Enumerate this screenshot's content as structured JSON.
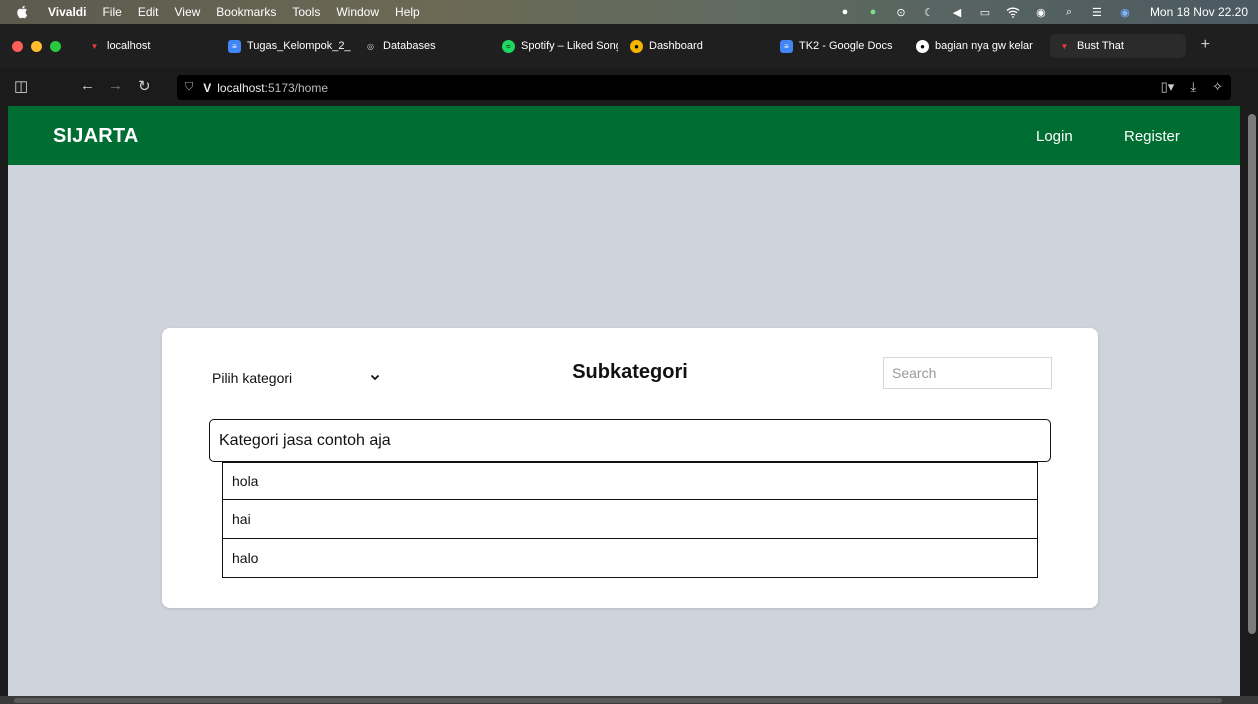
{
  "menubar": {
    "app_name": "Vivaldi",
    "items": [
      "File",
      "Edit",
      "View",
      "Bookmarks",
      "Tools",
      "Window",
      "Help"
    ],
    "clock": "Mon 18 Nov 22.20"
  },
  "tabs": [
    {
      "label": "localhost",
      "icon": "vivaldi-icon",
      "color": "#ef3939"
    },
    {
      "label": "Tugas_Kelompok_2_",
      "icon": "docs-icon",
      "color": "#4285f4"
    },
    {
      "label": "Databases",
      "icon": "databases-icon",
      "color": "#9a9a9a"
    },
    {
      "label": "Spotify – Liked Songs",
      "icon": "spotify-icon",
      "color": "#1ed760"
    },
    {
      "label": "Dashboard",
      "icon": "dashboard-icon",
      "color": "#f5b400"
    },
    {
      "label": "TK2 - Google Docs",
      "icon": "docs-icon",
      "color": "#4285f4"
    },
    {
      "label": "bagian nya gw kelar",
      "icon": "github-icon",
      "color": "#ffffff"
    },
    {
      "label": "Bust That",
      "icon": "vivaldi-icon",
      "color": "#ef3939"
    }
  ],
  "address": {
    "url_host": "localhost",
    "url_path": ":5173/home"
  },
  "site": {
    "brand": "SIJARTA",
    "login": "Login",
    "register": "Register"
  },
  "card": {
    "category_select": "Pilih kategori",
    "title": "Subkategori",
    "search_placeholder": "Search",
    "category_header": "Kategori jasa contoh aja",
    "subcategories": [
      "hola",
      "hai",
      "halo"
    ]
  },
  "colors": {
    "navbar": "#006d32",
    "page_bg": "#cfd3dc"
  }
}
